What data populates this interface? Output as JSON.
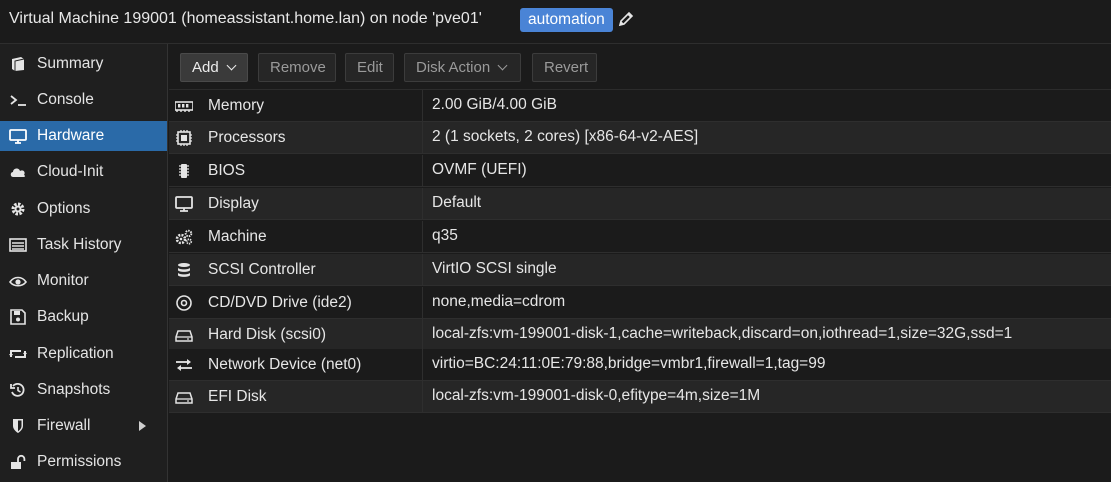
{
  "header": {
    "title": "Virtual Machine 199001 (homeassistant.home.lan) on node 'pve01'",
    "tag": "automation",
    "edit_icon": "pencil-icon"
  },
  "sidebar": {
    "items": [
      {
        "label": "Summary",
        "icon": "book-icon"
      },
      {
        "label": "Console",
        "icon": "terminal-icon"
      },
      {
        "label": "Hardware",
        "icon": "monitor-icon",
        "active": true
      },
      {
        "label": "Cloud-Init",
        "icon": "cloud-icon"
      },
      {
        "label": "Options",
        "icon": "gear-icon"
      },
      {
        "label": "Task History",
        "icon": "list-icon"
      },
      {
        "label": "Monitor",
        "icon": "eye-icon"
      },
      {
        "label": "Backup",
        "icon": "floppy-icon"
      },
      {
        "label": "Replication",
        "icon": "retweet-icon"
      },
      {
        "label": "Snapshots",
        "icon": "history-icon"
      },
      {
        "label": "Firewall",
        "icon": "shield-icon",
        "has_submenu": true
      },
      {
        "label": "Permissions",
        "icon": "unlock-icon"
      }
    ]
  },
  "toolbar": {
    "add": "Add",
    "remove": "Remove",
    "edit": "Edit",
    "disk_action": "Disk Action",
    "revert": "Revert"
  },
  "hardware": [
    {
      "name": "Memory",
      "value": "2.00 GiB/4.00 GiB",
      "icon": "memory-icon"
    },
    {
      "name": "Processors",
      "value": "2 (1 sockets, 2 cores) [x86-64-v2-AES]",
      "icon": "cpu-icon"
    },
    {
      "name": "BIOS",
      "value": "OVMF (UEFI)",
      "icon": "microchip-icon"
    },
    {
      "name": "Display",
      "value": "Default",
      "icon": "desktop-icon"
    },
    {
      "name": "Machine",
      "value": "q35",
      "icon": "cogs-icon"
    },
    {
      "name": "SCSI Controller",
      "value": "VirtIO SCSI single",
      "icon": "database-icon"
    },
    {
      "name": "CD/DVD Drive (ide2)",
      "value": "none,media=cdrom",
      "icon": "cdrom-icon"
    },
    {
      "name": "Hard Disk (scsi0)",
      "value": "local-zfs:vm-199001-disk-1,cache=writeback,discard=on,iothread=1,size=32G,ssd=1",
      "icon": "hdd-icon"
    },
    {
      "name": "Network Device (net0)",
      "value": "virtio=BC:24:11:0E:79:88,bridge=vmbr1,firewall=1,tag=99",
      "icon": "exchange-icon"
    },
    {
      "name": "EFI Disk",
      "value": "local-zfs:vm-199001-disk-0,efitype=4m,size=1M",
      "icon": "hdd-icon"
    }
  ],
  "colors": {
    "accent": "#4a84d6",
    "active_nav": "#2a6aa8",
    "background": "#1b1b1b"
  }
}
